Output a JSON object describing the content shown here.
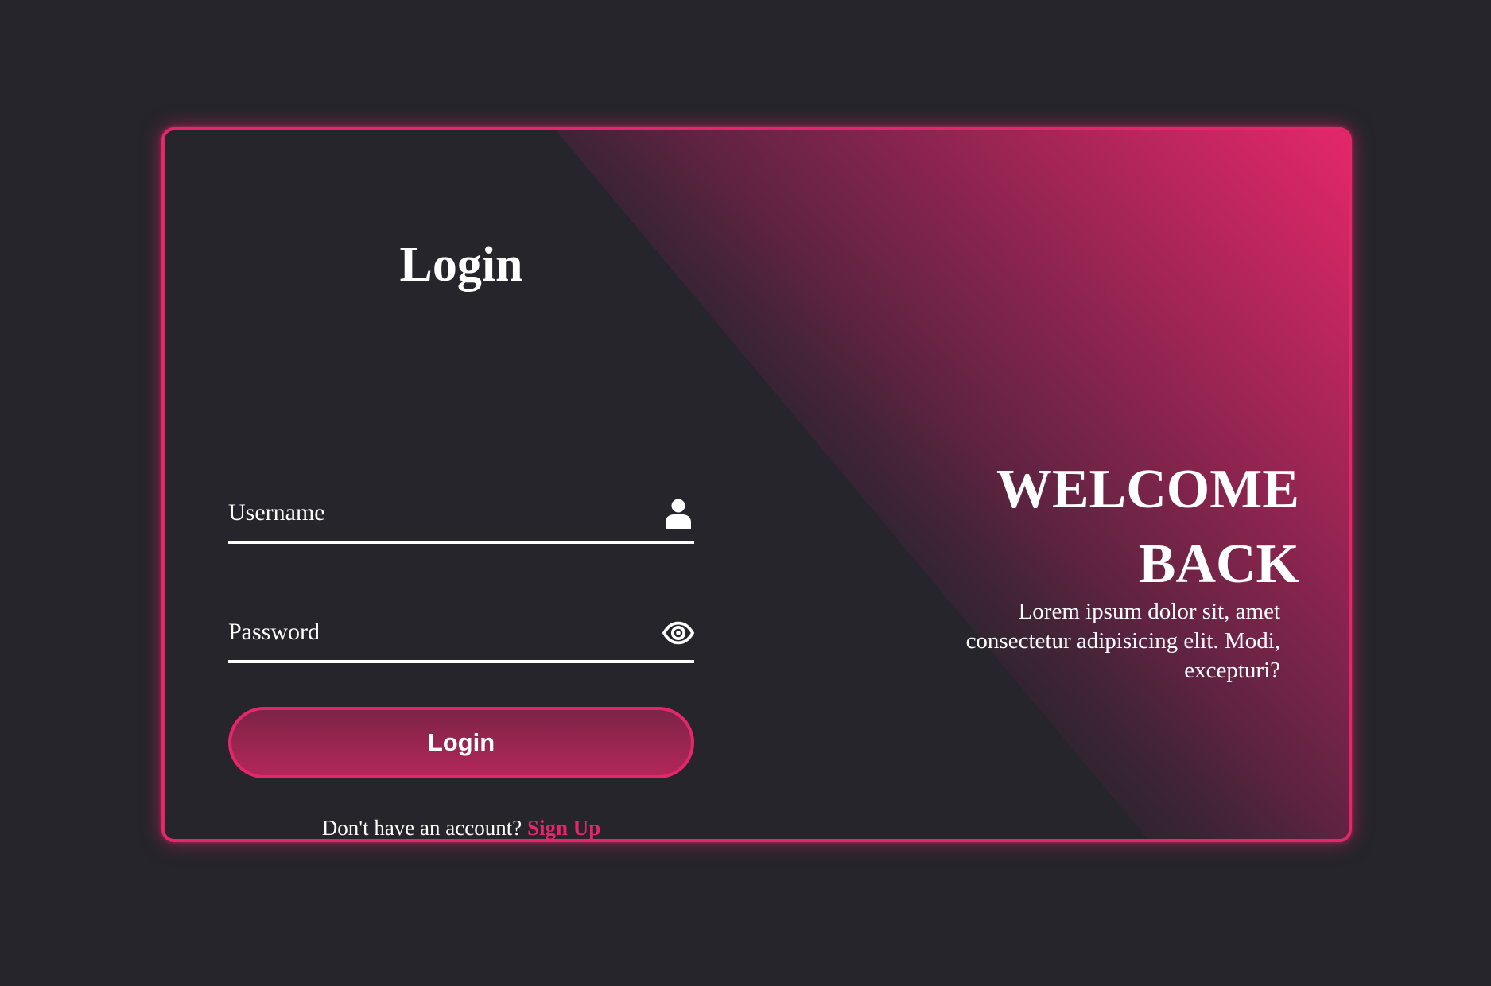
{
  "colors": {
    "page_background": "#25252b",
    "accent": "#e4276a",
    "gradient_dark": "#25252b",
    "gradient_light": "#e4276a"
  },
  "login_form": {
    "title": "Login",
    "username": {
      "placeholder": "Username",
      "value": "",
      "icon": "user-icon"
    },
    "password": {
      "placeholder": "Password",
      "value": "",
      "icon": "eye-icon"
    },
    "submit_label": "Login",
    "signup_prompt": "Don't have an account?",
    "signup_link": "Sign Up"
  },
  "welcome_panel": {
    "title": "WELCOME BACK",
    "text": "Lorem ipsum dolor sit, amet consectetur adipisicing elit. Modi, excepturi?"
  }
}
